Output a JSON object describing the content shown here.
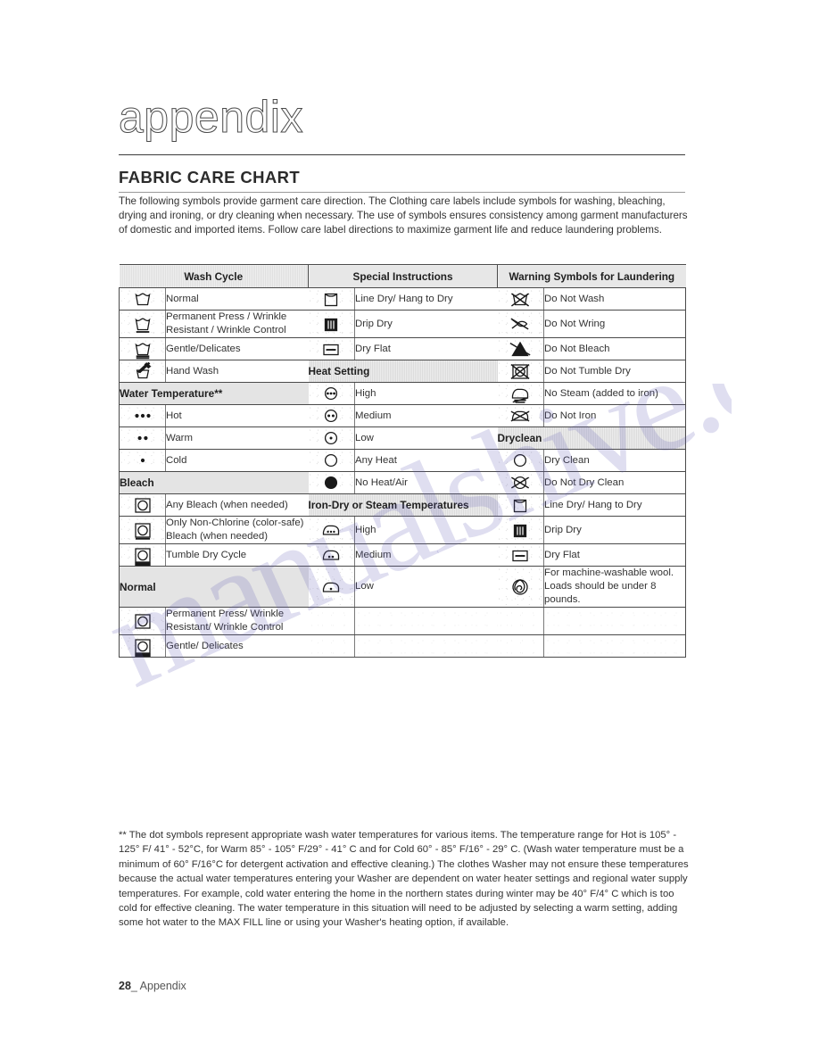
{
  "masthead": {
    "title": "appendix"
  },
  "section": {
    "heading": "FABRIC CARE CHART",
    "intro": "The following symbols provide garment care direction. The Clothing care labels include symbols for washing, bleaching, drying and ironing, or dry cleaning when necessary. The use of symbols ensures consistency among garment manufacturers of domestic and imported items. Follow care label directions to maximize garment life and reduce laundering problems."
  },
  "watermark": {
    "text": "manualshive.com"
  },
  "table": {
    "headers": {
      "col1": "Wash Cycle",
      "col2": "Special Instructions",
      "col3": "Warning Symbols for Laundering"
    },
    "col1": [
      {
        "kind": "row",
        "icon": "wash-tub-icon",
        "label": "Normal"
      },
      {
        "kind": "row",
        "icon": "wash-tub-1bar-icon",
        "label": "Permanent Press / Wrinkle Resistant / Wrinkle Control"
      },
      {
        "kind": "row",
        "icon": "wash-tub-2bar-icon",
        "label": "Gentle/Delicates"
      },
      {
        "kind": "row",
        "icon": "hand-wash-icon",
        "label": "Hand Wash"
      },
      {
        "kind": "band",
        "label": "Water Temperature**"
      },
      {
        "kind": "row",
        "icon": "three-dots-icon",
        "label": "Hot"
      },
      {
        "kind": "row",
        "icon": "two-dots-icon",
        "label": "Warm"
      },
      {
        "kind": "row",
        "icon": "one-dot-icon",
        "label": "Cold"
      },
      {
        "kind": "band",
        "label": "Bleach"
      },
      {
        "kind": "row",
        "icon": "square-circle-icon",
        "label": "Any Bleach (when needed)"
      },
      {
        "kind": "row",
        "icon": "square-circle-1bar-icon",
        "label": "Only Non-Chlorine (color-safe)\nBleach (when needed)"
      },
      {
        "kind": "row",
        "icon": "square-circle-2bar-icon",
        "label": "Tumble Dry Cycle"
      },
      {
        "kind": "band",
        "label": "Normal"
      },
      {
        "kind": "row",
        "icon": "square-circle-icon",
        "label": "Permanent Press/ Wrinkle Resistant/ Wrinkle Control"
      },
      {
        "kind": "row",
        "icon": "square-circle-2bar-icon",
        "label": "Gentle/ Delicates"
      }
    ],
    "col2": [
      {
        "kind": "row",
        "icon": "line-dry-icon",
        "label": "Line Dry/ Hang to Dry"
      },
      {
        "kind": "row",
        "icon": "drip-dry-icon",
        "label": "Drip Dry"
      },
      {
        "kind": "row",
        "icon": "dry-flat-icon",
        "label": "Dry Flat"
      },
      {
        "kind": "band",
        "label": "Heat Setting"
      },
      {
        "kind": "row",
        "icon": "circle-three-dots-icon",
        "label": "High"
      },
      {
        "kind": "row",
        "icon": "circle-two-dots-icon",
        "label": "Medium"
      },
      {
        "kind": "row",
        "icon": "circle-one-dot-icon",
        "label": "Low"
      },
      {
        "kind": "row",
        "icon": "circle-empty-icon",
        "label": "Any Heat"
      },
      {
        "kind": "row",
        "icon": "circle-filled-icon",
        "label": "No Heat/Air"
      },
      {
        "kind": "band",
        "label": "Iron-Dry or Steam Temperatures"
      },
      {
        "kind": "row",
        "icon": "iron-three-dots-icon",
        "label": "High"
      },
      {
        "kind": "row",
        "icon": "iron-two-dots-icon",
        "label": "Medium"
      },
      {
        "kind": "row",
        "icon": "iron-one-dot-icon",
        "label": "Low"
      },
      {
        "kind": "blank",
        "icon": "",
        "label": ""
      },
      {
        "kind": "blank",
        "icon": "",
        "label": ""
      }
    ],
    "col3": [
      {
        "kind": "row",
        "icon": "do-not-wash-icon",
        "label": "Do Not Wash"
      },
      {
        "kind": "row",
        "icon": "do-not-wring-icon",
        "label": "Do Not Wring"
      },
      {
        "kind": "row",
        "icon": "do-not-bleach-icon",
        "label": "Do Not Bleach"
      },
      {
        "kind": "row",
        "icon": "do-not-tumble-dry-icon",
        "label": "Do Not Tumble Dry"
      },
      {
        "kind": "row",
        "icon": "no-steam-icon",
        "label": "No Steam (added to iron)"
      },
      {
        "kind": "row",
        "icon": "do-not-iron-icon",
        "label": "Do Not Iron"
      },
      {
        "kind": "band",
        "label": "Dryclean"
      },
      {
        "kind": "row",
        "icon": "circle-empty-icon",
        "label": "Dry Clean"
      },
      {
        "kind": "row",
        "icon": "do-not-dry-clean-icon",
        "label": "Do Not Dry Clean"
      },
      {
        "kind": "row",
        "icon": "line-dry-icon",
        "label": "Line Dry/ Hang to Dry"
      },
      {
        "kind": "row",
        "icon": "drip-dry-icon",
        "label": "Drip Dry"
      },
      {
        "kind": "row",
        "icon": "dry-flat-icon",
        "label": "Dry Flat"
      },
      {
        "kind": "row",
        "icon": "wool-icon",
        "label": "For machine-washable wool. Loads should be under 8 pounds."
      },
      {
        "kind": "blank",
        "icon": "",
        "label": ""
      },
      {
        "kind": "blank",
        "icon": "",
        "label": ""
      }
    ]
  },
  "footnote": "** The dot symbols represent appropriate wash water temperatures for various items. The temperature range for Hot is 105° - 125° F/ 41° - 52°C, for Warm 85° - 105° F/29° - 41° C and for Cold 60° - 85° F/16° - 29° C. (Wash water temperature must be a minimum of 60° F/16°C for detergent activation and effective cleaning.) The clothes Washer may not ensure these temperatures because the actual water temperatures entering your Washer are dependent on water heater settings and regional water supply temperatures. For example, cold water entering the home in the northern states during winter may be 40° F/4° C which is too cold for effective cleaning. The water temperature in this situation will need to be adjusted by selecting a warm setting, adding some hot water to the MAX FILL line or using your Washer's heating option, if available.",
  "footer": {
    "page_number": "28",
    "separator": "_",
    "label": "Appendix"
  }
}
